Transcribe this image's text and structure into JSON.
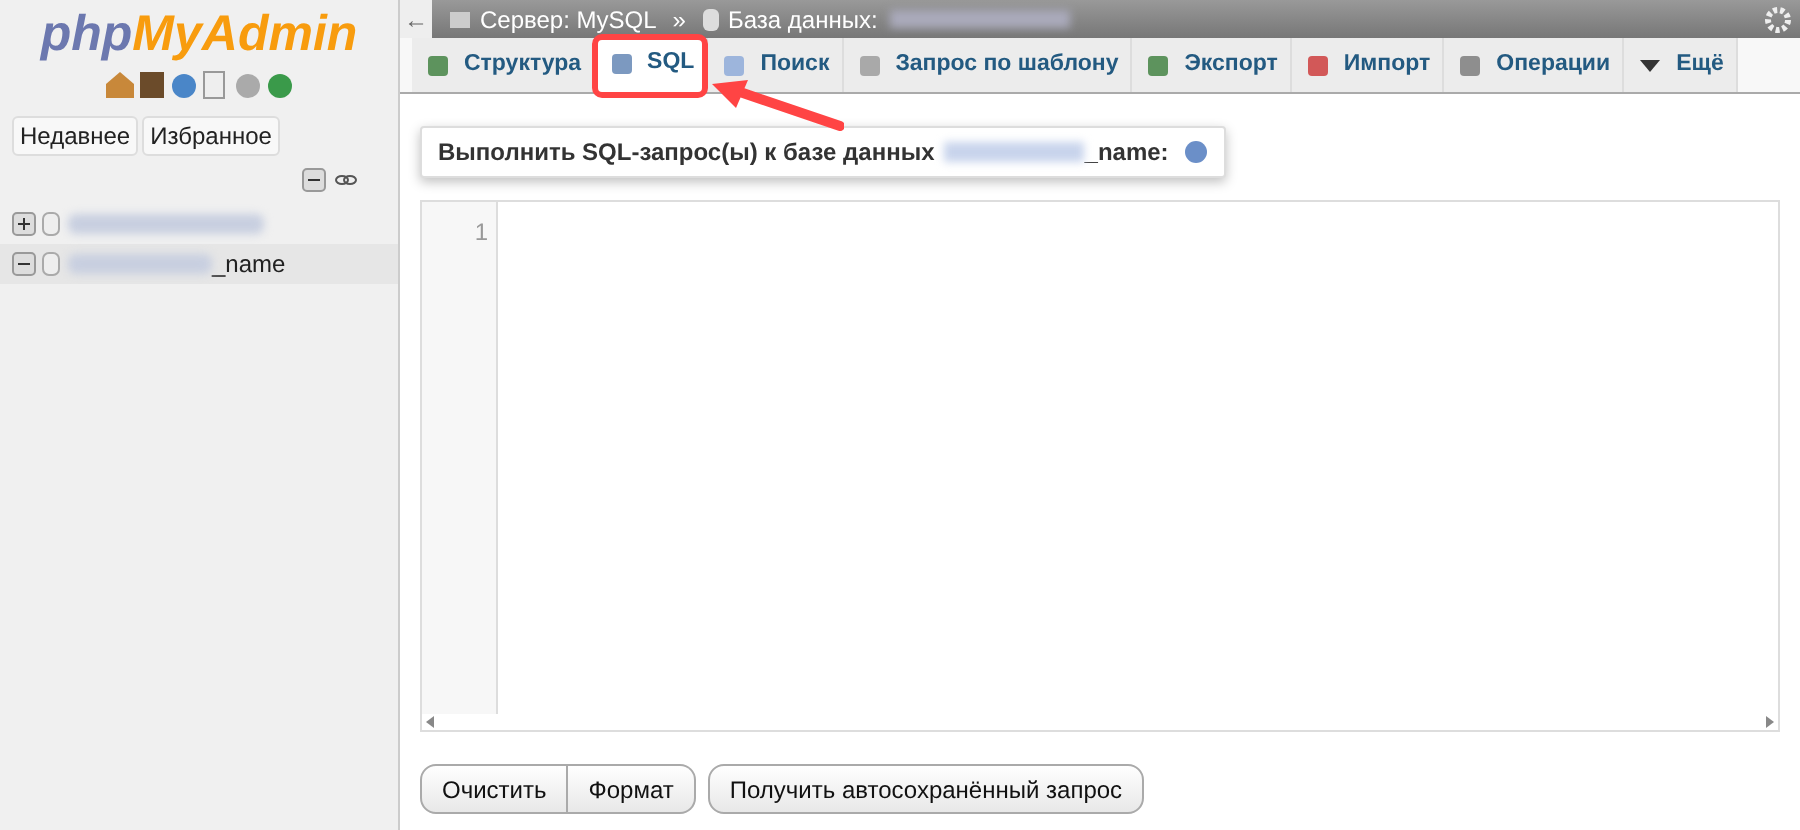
{
  "sidebar": {
    "logo": {
      "part_1": "php",
      "part_2": "MyAdmin"
    },
    "buttons": [
      {
        "label": "Недавнее"
      },
      {
        "label": "Избранное"
      }
    ],
    "databases": [
      {
        "expanded": false
      },
      {
        "name_suffix": "_name",
        "expanded": true
      }
    ]
  },
  "breadcrumb": {
    "back": "←",
    "server": "Сервер: MySQL",
    "separator": "»",
    "database": "База данных:"
  },
  "tabs": [
    {
      "label": "Структура",
      "selected": false
    },
    {
      "label": "SQL",
      "selected": true
    },
    {
      "label": "Поиск",
      "selected": false
    },
    {
      "label": "Запрос по шаблону",
      "selected": false
    },
    {
      "label": "Экспорт",
      "selected": false
    },
    {
      "label": "Импорт",
      "selected": false
    },
    {
      "label": "Операции",
      "selected": false
    },
    {
      "label": "Ещё",
      "selected": false
    }
  ],
  "heading": {
    "text": "Выполнить SQL-запрос(ы) к базе данных",
    "suffix": "_name:"
  },
  "editor": {
    "line_numbers": [
      "1"
    ]
  },
  "buttons": [
    {
      "label": "Очистить"
    },
    {
      "label": "Формат"
    },
    {
      "label": "Получить автосохранённый запрос"
    }
  ]
}
